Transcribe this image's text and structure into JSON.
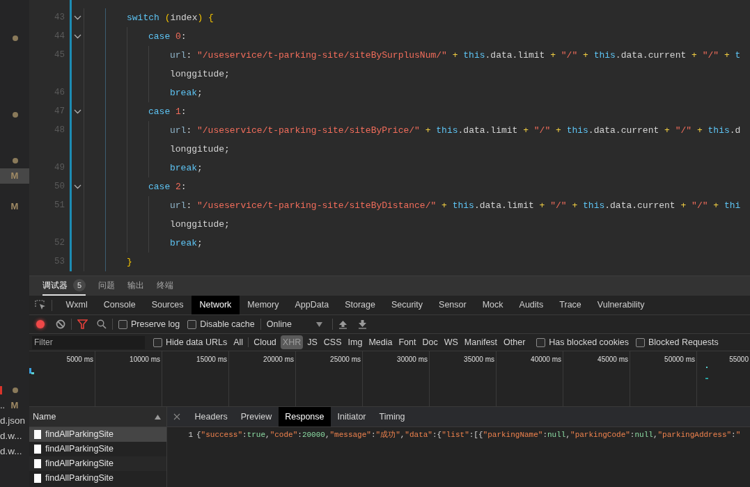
{
  "explorer": {
    "items": [
      {
        "selected": false,
        "error": false,
        "status": {
          "kind": "dot"
        }
      },
      {
        "selected": false,
        "error": false,
        "status": {
          "kind": "dot"
        }
      },
      {
        "selected": false,
        "error": false,
        "status": {
          "kind": "dot"
        }
      },
      {
        "selected": true,
        "error": false,
        "status": {
          "kind": "letter",
          "text": "M"
        }
      },
      {
        "selected": false,
        "error": false,
        "status": {
          "kind": "letter",
          "text": "M"
        }
      },
      {
        "selected": false,
        "error": true,
        "status": {
          "kind": "dot"
        }
      },
      {
        "selected": false,
        "error": false,
        "name": "..",
        "status": {
          "kind": "letter",
          "text": "M"
        }
      },
      {
        "selected": false,
        "error": false,
        "name": "d.json"
      },
      {
        "selected": false,
        "error": false,
        "name": "d.w..."
      },
      {
        "selected": false,
        "error": false,
        "name": "d.w..."
      }
    ]
  },
  "editor": {
    "lines": [
      {
        "number": "43",
        "foldable": true,
        "rows": [
          [
            {
              "kind": "keyword",
              "text": "switch"
            },
            {
              "kind": "plain",
              "text": " "
            },
            {
              "kind": "brace",
              "text": "("
            },
            {
              "kind": "plain",
              "text": "index"
            },
            {
              "kind": "brace",
              "text": ")"
            },
            {
              "kind": "plain",
              "text": " "
            },
            {
              "kind": "brace",
              "text": "{"
            }
          ]
        ],
        "children": [
          {
            "number": "44",
            "foldable": true,
            "rows": [
              [
                {
                  "kind": "keyword",
                  "text": "case"
                },
                {
                  "kind": "plain",
                  "text": " "
                },
                {
                  "kind": "number",
                  "text": "0"
                },
                {
                  "kind": "plain",
                  "text": ":"
                }
              ]
            ],
            "children": [
              {
                "number": "45",
                "foldable": false,
                "rows": [
                  [
                    {
                      "kind": "property",
                      "text": "url"
                    },
                    {
                      "kind": "plain",
                      "text": ": "
                    },
                    {
                      "kind": "string",
                      "text": "\"/useservice/t-parking-site/siteBySurplusNum/\""
                    },
                    {
                      "kind": "plain",
                      "text": " "
                    },
                    {
                      "kind": "operator",
                      "text": "+"
                    },
                    {
                      "kind": "plain",
                      "text": " "
                    },
                    {
                      "kind": "keyword",
                      "text": "this"
                    },
                    {
                      "kind": "plain",
                      "text": ".data.limit "
                    },
                    {
                      "kind": "operator",
                      "text": "+"
                    },
                    {
                      "kind": "plain",
                      "text": " "
                    },
                    {
                      "kind": "string",
                      "text": "\"/\""
                    },
                    {
                      "kind": "plain",
                      "text": " "
                    },
                    {
                      "kind": "operator",
                      "text": "+"
                    },
                    {
                      "kind": "plain",
                      "text": " "
                    },
                    {
                      "kind": "keyword",
                      "text": "this"
                    },
                    {
                      "kind": "plain",
                      "text": ".data.current "
                    },
                    {
                      "kind": "operator",
                      "text": "+"
                    },
                    {
                      "kind": "plain",
                      "text": " "
                    },
                    {
                      "kind": "string",
                      "text": "\"/\""
                    },
                    {
                      "kind": "plain",
                      "text": " "
                    },
                    {
                      "kind": "operator",
                      "text": "+"
                    },
                    {
                      "kind": "plain",
                      "text": " "
                    },
                    {
                      "kind": "keyword",
                      "text": "t"
                    }
                  ],
                  [
                    {
                      "kind": "plain",
                      "text": "longgitude;"
                    }
                  ]
                ]
              },
              {
                "number": "46",
                "foldable": false,
                "rows": [
                  [
                    {
                      "kind": "keyword",
                      "text": "break"
                    },
                    {
                      "kind": "plain",
                      "text": ";"
                    }
                  ]
                ]
              }
            ]
          },
          {
            "number": "47",
            "foldable": true,
            "rows": [
              [
                {
                  "kind": "keyword",
                  "text": "case"
                },
                {
                  "kind": "plain",
                  "text": " "
                },
                {
                  "kind": "number",
                  "text": "1"
                },
                {
                  "kind": "plain",
                  "text": ":"
                }
              ]
            ],
            "children": [
              {
                "number": "48",
                "foldable": false,
                "rows": [
                  [
                    {
                      "kind": "property",
                      "text": "url"
                    },
                    {
                      "kind": "plain",
                      "text": ": "
                    },
                    {
                      "kind": "string",
                      "text": "\"/useservice/t-parking-site/siteByPrice/\""
                    },
                    {
                      "kind": "plain",
                      "text": " "
                    },
                    {
                      "kind": "operator",
                      "text": "+"
                    },
                    {
                      "kind": "plain",
                      "text": " "
                    },
                    {
                      "kind": "keyword",
                      "text": "this"
                    },
                    {
                      "kind": "plain",
                      "text": ".data.limit "
                    },
                    {
                      "kind": "operator",
                      "text": "+"
                    },
                    {
                      "kind": "plain",
                      "text": " "
                    },
                    {
                      "kind": "string",
                      "text": "\"/\""
                    },
                    {
                      "kind": "plain",
                      "text": " "
                    },
                    {
                      "kind": "operator",
                      "text": "+"
                    },
                    {
                      "kind": "plain",
                      "text": " "
                    },
                    {
                      "kind": "keyword",
                      "text": "this"
                    },
                    {
                      "kind": "plain",
                      "text": ".data.current "
                    },
                    {
                      "kind": "operator",
                      "text": "+"
                    },
                    {
                      "kind": "plain",
                      "text": " "
                    },
                    {
                      "kind": "string",
                      "text": "\"/\""
                    },
                    {
                      "kind": "plain",
                      "text": " "
                    },
                    {
                      "kind": "operator",
                      "text": "+"
                    },
                    {
                      "kind": "plain",
                      "text": " "
                    },
                    {
                      "kind": "keyword",
                      "text": "this"
                    },
                    {
                      "kind": "plain",
                      "text": ".d"
                    }
                  ],
                  [
                    {
                      "kind": "plain",
                      "text": "longgitude;"
                    }
                  ]
                ]
              },
              {
                "number": "49",
                "foldable": false,
                "rows": [
                  [
                    {
                      "kind": "keyword",
                      "text": "break"
                    },
                    {
                      "kind": "plain",
                      "text": ";"
                    }
                  ]
                ]
              }
            ]
          },
          {
            "number": "50",
            "foldable": true,
            "rows": [
              [
                {
                  "kind": "keyword",
                  "text": "case"
                },
                {
                  "kind": "plain",
                  "text": " "
                },
                {
                  "kind": "number",
                  "text": "2"
                },
                {
                  "kind": "plain",
                  "text": ":"
                }
              ]
            ],
            "children": [
              {
                "number": "51",
                "foldable": false,
                "rows": [
                  [
                    {
                      "kind": "property",
                      "text": "url"
                    },
                    {
                      "kind": "plain",
                      "text": ": "
                    },
                    {
                      "kind": "string",
                      "text": "\"/useservice/t-parking-site/siteByDistance/\""
                    },
                    {
                      "kind": "plain",
                      "text": " "
                    },
                    {
                      "kind": "operator",
                      "text": "+"
                    },
                    {
                      "kind": "plain",
                      "text": " "
                    },
                    {
                      "kind": "keyword",
                      "text": "this"
                    },
                    {
                      "kind": "plain",
                      "text": ".data.limit "
                    },
                    {
                      "kind": "operator",
                      "text": "+"
                    },
                    {
                      "kind": "plain",
                      "text": " "
                    },
                    {
                      "kind": "string",
                      "text": "\"/\""
                    },
                    {
                      "kind": "plain",
                      "text": " "
                    },
                    {
                      "kind": "operator",
                      "text": "+"
                    },
                    {
                      "kind": "plain",
                      "text": " "
                    },
                    {
                      "kind": "keyword",
                      "text": "this"
                    },
                    {
                      "kind": "plain",
                      "text": ".data.current "
                    },
                    {
                      "kind": "operator",
                      "text": "+"
                    },
                    {
                      "kind": "plain",
                      "text": " "
                    },
                    {
                      "kind": "string",
                      "text": "\"/\""
                    },
                    {
                      "kind": "plain",
                      "text": " "
                    },
                    {
                      "kind": "operator",
                      "text": "+"
                    },
                    {
                      "kind": "plain",
                      "text": " "
                    },
                    {
                      "kind": "keyword",
                      "text": "thi"
                    }
                  ],
                  [
                    {
                      "kind": "plain",
                      "text": "longgitude;"
                    }
                  ]
                ]
              },
              {
                "number": "52",
                "foldable": false,
                "rows": [
                  [
                    {
                      "kind": "keyword",
                      "text": "break"
                    },
                    {
                      "kind": "plain",
                      "text": ";"
                    }
                  ]
                ]
              }
            ]
          }
        ]
      },
      {
        "number": "53",
        "foldable": false,
        "rows": [
          [
            {
              "kind": "brace",
              "text": "}"
            }
          ]
        ]
      }
    ]
  },
  "panel_tabs": [
    {
      "label": "调试器",
      "badge": "5",
      "selected": true
    },
    {
      "label": "问题",
      "selected": false
    },
    {
      "label": "输出",
      "selected": false
    },
    {
      "label": "终端",
      "selected": false
    }
  ],
  "devtools_tabs": [
    {
      "label": "Wxml",
      "selected": false
    },
    {
      "label": "Console",
      "selected": false
    },
    {
      "label": "Sources",
      "selected": false
    },
    {
      "label": "Network",
      "selected": true
    },
    {
      "label": "Memory",
      "selected": false
    },
    {
      "label": "AppData",
      "selected": false
    },
    {
      "label": "Storage",
      "selected": false
    },
    {
      "label": "Security",
      "selected": false
    },
    {
      "label": "Sensor",
      "selected": false
    },
    {
      "label": "Mock",
      "selected": false
    },
    {
      "label": "Audits",
      "selected": false
    },
    {
      "label": "Trace",
      "selected": false
    },
    {
      "label": "Vulnerability",
      "selected": false
    }
  ],
  "network": {
    "toolbar": {
      "recording": true,
      "preserve_log": {
        "label": "Preserve log",
        "checked": false
      },
      "disable_cache": {
        "label": "Disable cache",
        "checked": false
      },
      "throttling": "Online"
    },
    "filter": {
      "placeholder": "Filter",
      "hide_data_urls": {
        "label": "Hide data URLs",
        "checked": false
      },
      "types": [
        {
          "label": "All",
          "selected": false
        },
        {
          "label": "Cloud",
          "selected": false
        },
        {
          "label": "XHR",
          "selected": true
        },
        {
          "label": "JS",
          "selected": false
        },
        {
          "label": "CSS",
          "selected": false
        },
        {
          "label": "Img",
          "selected": false
        },
        {
          "label": "Media",
          "selected": false
        },
        {
          "label": "Font",
          "selected": false
        },
        {
          "label": "Doc",
          "selected": false
        },
        {
          "label": "WS",
          "selected": false
        },
        {
          "label": "Manifest",
          "selected": false
        },
        {
          "label": "Other",
          "selected": false
        }
      ],
      "has_blocked_cookies": {
        "label": "Has blocked cookies",
        "checked": false
      },
      "blocked_requests": {
        "label": "Blocked Requests",
        "checked": false
      }
    },
    "timeline": {
      "ticks": [
        "5000 ms",
        "10000 ms",
        "15000 ms",
        "20000 ms",
        "25000 ms",
        "30000 ms",
        "35000 ms",
        "40000 ms",
        "45000 ms",
        "50000 ms",
        "55000"
      ]
    },
    "requests": {
      "column": "Name",
      "rows": [
        {
          "name": "findAllParkingSite",
          "selected": true
        },
        {
          "name": "findAllParkingSite",
          "selected": false
        },
        {
          "name": "findAllParkingSite",
          "selected": false
        },
        {
          "name": "findAllParkingSite",
          "selected": false
        }
      ]
    },
    "detail": {
      "tabs": [
        {
          "label": "Headers",
          "selected": false
        },
        {
          "label": "Preview",
          "selected": false
        },
        {
          "label": "Response",
          "selected": true
        },
        {
          "label": "Initiator",
          "selected": false
        },
        {
          "label": "Timing",
          "selected": false
        }
      ],
      "response": {
        "line_number": "1",
        "tokens": [
          {
            "kind": "punct",
            "text": "{"
          },
          {
            "kind": "key",
            "text": "\"success\""
          },
          {
            "kind": "punct",
            "text": ":"
          },
          {
            "kind": "literal",
            "text": "true"
          },
          {
            "kind": "punct",
            "text": ","
          },
          {
            "kind": "key",
            "text": "\"code\""
          },
          {
            "kind": "punct",
            "text": ":"
          },
          {
            "kind": "literal",
            "text": "20000"
          },
          {
            "kind": "punct",
            "text": ","
          },
          {
            "kind": "key",
            "text": "\"message\""
          },
          {
            "kind": "punct",
            "text": ":"
          },
          {
            "kind": "string",
            "text": "\"成功\""
          },
          {
            "kind": "punct",
            "text": ","
          },
          {
            "kind": "key",
            "text": "\"data\""
          },
          {
            "kind": "punct",
            "text": ":{"
          },
          {
            "kind": "key",
            "text": "\"list\""
          },
          {
            "kind": "punct",
            "text": ":[{"
          },
          {
            "kind": "key",
            "text": "\"parkingName\""
          },
          {
            "kind": "punct",
            "text": ":"
          },
          {
            "kind": "literal",
            "text": "null"
          },
          {
            "kind": "punct",
            "text": ","
          },
          {
            "kind": "key",
            "text": "\"parkingCode\""
          },
          {
            "kind": "punct",
            "text": ":"
          },
          {
            "kind": "literal",
            "text": "null"
          },
          {
            "kind": "punct",
            "text": ","
          },
          {
            "kind": "key",
            "text": "\"parkingAddress\""
          },
          {
            "kind": "punct",
            "text": ":"
          },
          {
            "kind": "string",
            "text": "\""
          }
        ]
      }
    }
  }
}
